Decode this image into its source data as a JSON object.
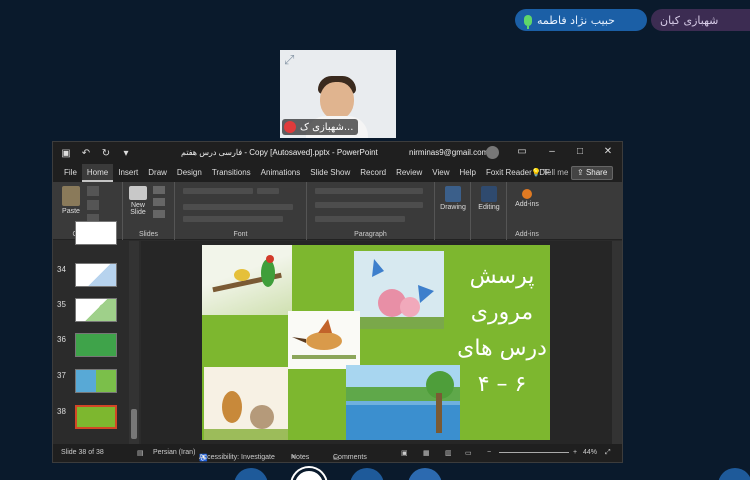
{
  "participants": {
    "speaking": "حبیب نژاد فاطمه",
    "other": "شهبازی کیان"
  },
  "webcam": {
    "name": "شهبازی ک..."
  },
  "ppt": {
    "title": "فارسی درس هفتم - Copy [Autosaved].pptx - PowerPoint",
    "email": "nirminas9@gmail.com",
    "tabs": [
      "File",
      "Home",
      "Insert",
      "Draw",
      "Design",
      "Transitions",
      "Animations",
      "Slide Show",
      "Record",
      "Review",
      "View",
      "Help",
      "Foxit Reader PDF"
    ],
    "tell_me": "Tell me",
    "share": "Share",
    "ribbon": {
      "paste": "Paste",
      "new_slide": "New Slide",
      "drawing": "Drawing",
      "editing": "Editing",
      "addins": "Add-ins",
      "groups": [
        "Clipboard",
        "Slides",
        "Font",
        "Paragraph",
        "Add-ins"
      ]
    },
    "thumbnails": [
      "34",
      "35",
      "36",
      "37",
      "38"
    ],
    "slide": {
      "lines": [
        "پرسش",
        "مروری",
        "درس های",
        "۴ – ۶"
      ]
    },
    "status": {
      "slide_of": "Slide 38 of 38",
      "language": "Persian (Iran)",
      "accessibility": "Accessibility: Investigate",
      "notes": "Notes",
      "comments": "Comments",
      "zoom": "44%"
    }
  },
  "colors": {
    "background": "#0a1a2c",
    "slide_green": "#7db72f",
    "chip_blue": "#1b5fa6",
    "chip_purple": "#3c2c52"
  }
}
